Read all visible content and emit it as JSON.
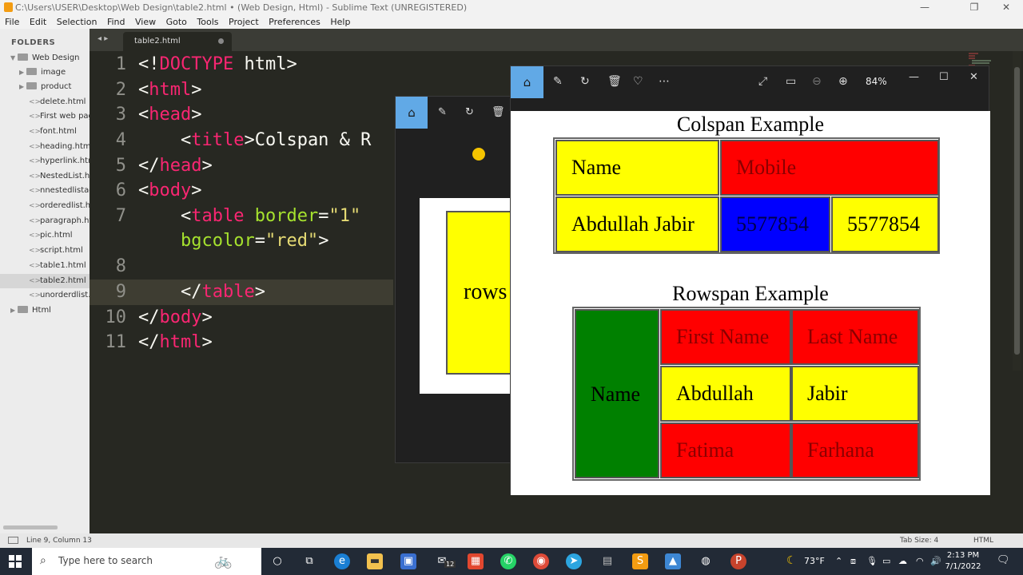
{
  "window": {
    "title": "C:\\Users\\USER\\Desktop\\Web Design\\table2.html • (Web Design, Html) - Sublime Text (UNREGISTERED)",
    "minimize": "—",
    "maximize": "❐",
    "close": "✕"
  },
  "menu": [
    "File",
    "Edit",
    "Selection",
    "Find",
    "View",
    "Goto",
    "Tools",
    "Project",
    "Preferences",
    "Help"
  ],
  "sidebar": {
    "header": "FOLDERS",
    "root": "Web Design",
    "items": [
      {
        "label": "image",
        "type": "folder"
      },
      {
        "label": "product",
        "type": "folder"
      },
      {
        "label": "delete.html",
        "type": "file"
      },
      {
        "label": "First web pag",
        "type": "file"
      },
      {
        "label": "font.html",
        "type": "file"
      },
      {
        "label": "heading.html",
        "type": "file"
      },
      {
        "label": "hyperlink.htm",
        "type": "file"
      },
      {
        "label": "NestedList.htr",
        "type": "file"
      },
      {
        "label": "nnestedlistad",
        "type": "file"
      },
      {
        "label": "orderedlist.ht",
        "type": "file"
      },
      {
        "label": "paragraph.htr",
        "type": "file"
      },
      {
        "label": "pic.html",
        "type": "file"
      },
      {
        "label": "script.html",
        "type": "file"
      },
      {
        "label": "table1.html",
        "type": "file"
      },
      {
        "label": "table2.html",
        "type": "file",
        "selected": true
      },
      {
        "label": "unorderdlist.h",
        "type": "file"
      }
    ],
    "root2": "Html"
  },
  "tab": {
    "label": "table2.html",
    "arrows": "◂ ▸"
  },
  "editor": {
    "line_numbers": [
      "1",
      "2",
      "3",
      "4",
      "5",
      "6",
      "7",
      "",
      "8",
      "9",
      "10",
      "11"
    ],
    "lines": {
      "l1": {
        "a": "<!",
        "b": "DOCTYPE",
        "c": " html>"
      },
      "l2": {
        "a": "<",
        "b": "html",
        "c": ">"
      },
      "l3": {
        "a": "<",
        "b": "head",
        "c": ">"
      },
      "l4": {
        "a": "    <",
        "b": "title",
        "c": ">Colspan & R"
      },
      "l5": {
        "a": "</",
        "b": "head",
        "c": ">"
      },
      "l6": {
        "a": "<",
        "b": "body",
        "c": ">"
      },
      "l7": {
        "a": "    <",
        "b": "table",
        "c": " ",
        "d": "border",
        "e": "=",
        "f": "\"1\""
      },
      "l7b": {
        "a": "    ",
        "d": "bgcolor",
        "e": "=",
        "f": "\"red\"",
        "g": ">"
      },
      "l9": {
        "a": "    </",
        "b": "table",
        "c": ">"
      },
      "l10": {
        "a": "</",
        "b": "body",
        "c": ">"
      },
      "l11": {
        "a": "</",
        "b": "html",
        "c": ">"
      }
    }
  },
  "status": {
    "position": "Line 9, Column 13",
    "tabsize": "Tab Size: 4",
    "syntax": "HTML"
  },
  "viewer_back": {
    "cell_text": "rows"
  },
  "viewer": {
    "zoom": "84%",
    "colspan": {
      "caption": "Colspan Example",
      "cells": {
        "name": "Name",
        "mobile": "Mobile",
        "person": "Abdullah Jabir",
        "phone1": "5577854",
        "phone2": "5577854"
      },
      "colors": {
        "name": "#ffff00",
        "mobile": "#ff0000",
        "person": "#ffff00",
        "phone1": "#0000ff",
        "phone2": "#ffff00"
      }
    },
    "rowspan": {
      "caption": "Rowspan Example",
      "cells": {
        "name": "Name",
        "first": "First Name",
        "last": "Last Name",
        "r1a": "Abdullah",
        "r1b": "Jabir",
        "r2a": "Fatima",
        "r2b": "Farhana"
      },
      "colors": {
        "name": "#008000",
        "header": "#ff0000",
        "row1": "#ffff00",
        "row2": "#ff0000"
      }
    }
  },
  "taskbar": {
    "search_placeholder": "Type here to search",
    "mail_badge": "12",
    "weather": "73°F",
    "time": "2:13 PM",
    "date": "7/1/2022"
  }
}
